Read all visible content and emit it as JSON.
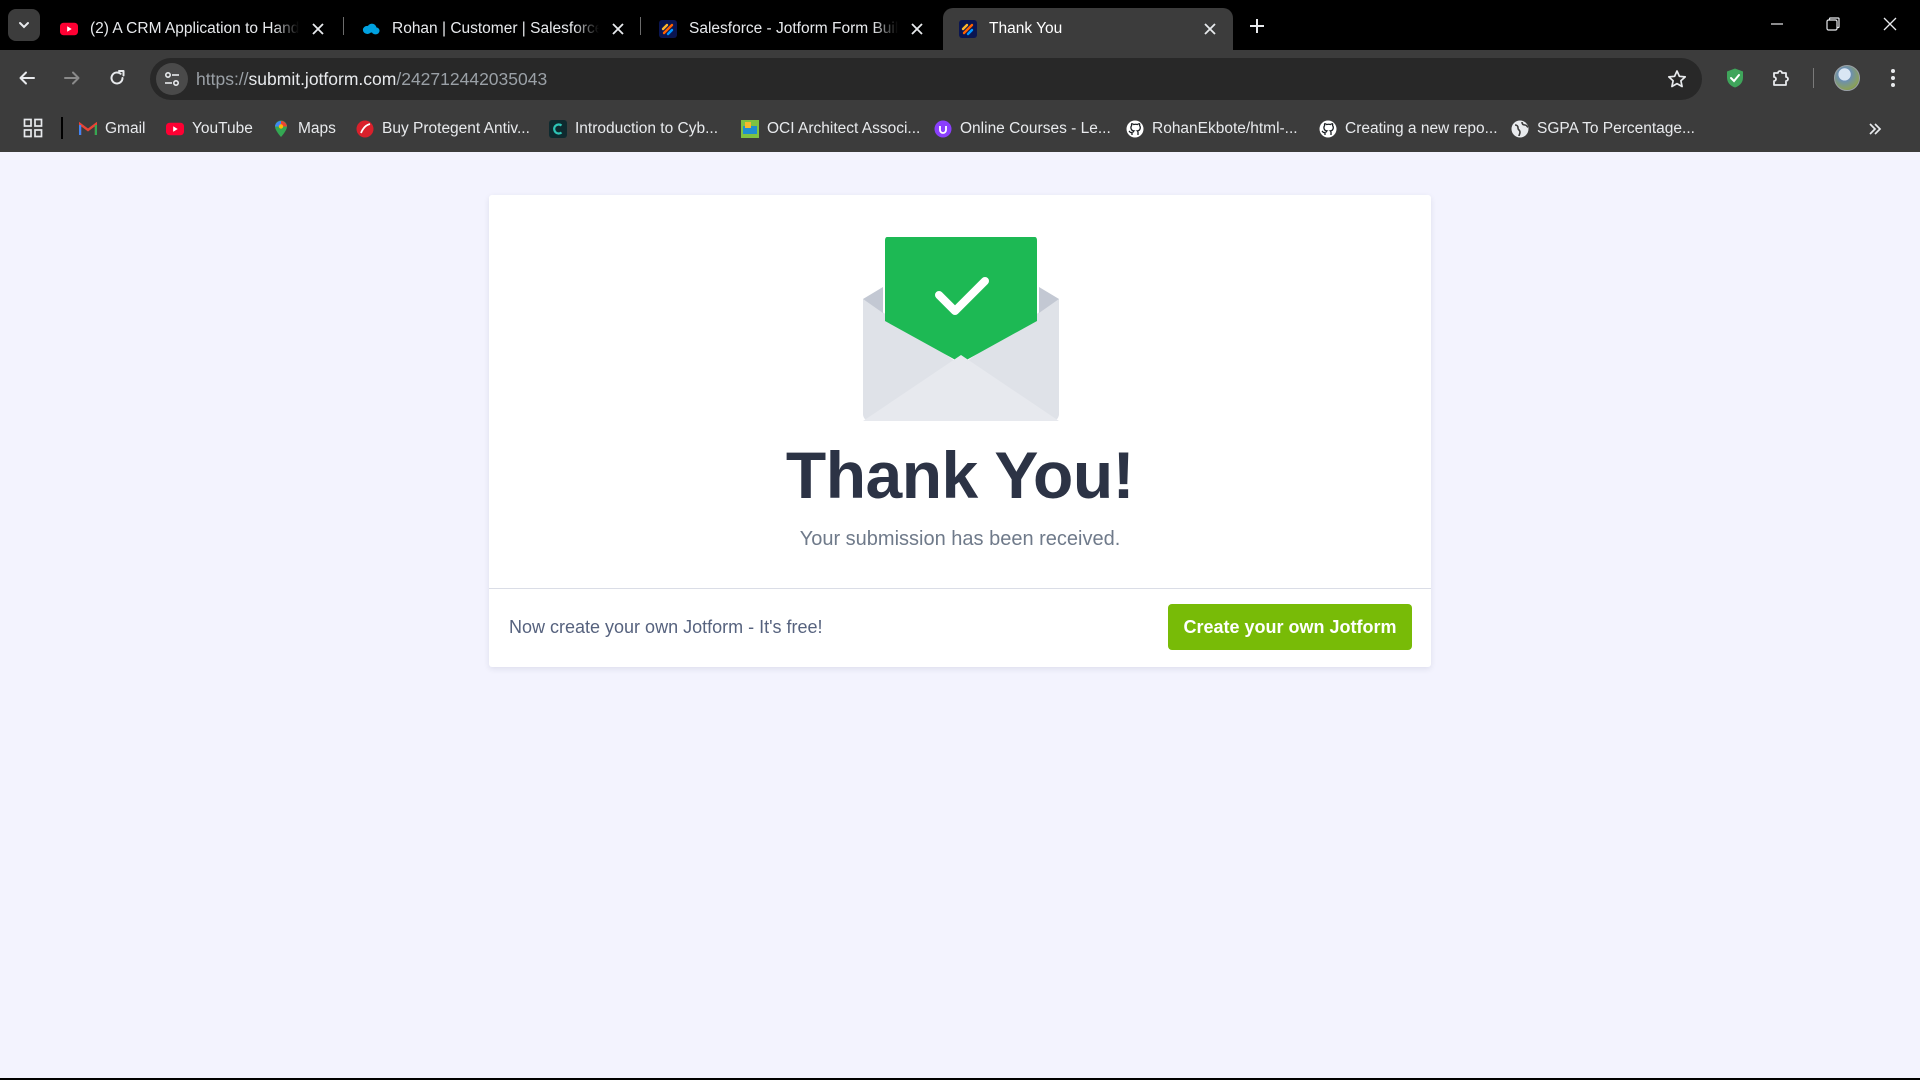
{
  "browser": {
    "tabs": [
      {
        "title": "(2) A CRM Application to Handl",
        "favicon": "youtube-icon"
      },
      {
        "title": "Rohan | Customer | Salesforce",
        "favicon": "salesforce-icon"
      },
      {
        "title": "Salesforce - Jotform Form Build",
        "favicon": "jotform-icon"
      },
      {
        "title": "Thank You",
        "favicon": "jotform-icon",
        "active": true
      }
    ],
    "url_scheme": "https://",
    "url_host": "submit.jotform.com",
    "url_path": "/242712442035043",
    "bookmarks": [
      {
        "label": "Gmail",
        "icon": "gmail-icon"
      },
      {
        "label": "YouTube",
        "icon": "youtube-icon"
      },
      {
        "label": "Maps",
        "icon": "maps-icon"
      },
      {
        "label": "Buy Protegent Antiv...",
        "icon": "protegent-icon"
      },
      {
        "label": "Introduction to Cyb...",
        "icon": "course-icon"
      },
      {
        "label": "OCI Architect Associ...",
        "icon": "oci-icon"
      },
      {
        "label": "Online Courses - Le...",
        "icon": "udemy-icon"
      },
      {
        "label": "RohanEkbote/html-...",
        "icon": "github-icon"
      },
      {
        "label": "Creating a new repo...",
        "icon": "github-icon"
      },
      {
        "label": "SGPA To Percentage...",
        "icon": "globe-icon"
      }
    ]
  },
  "page": {
    "title": "Thank You!",
    "subtitle": "Your submission has been received.",
    "footer_text": "Now create your own Jotform - It's free!",
    "cta_label": "Create your own Jotform"
  },
  "colors": {
    "accent_green": "#78bb07",
    "envelope_green": "#1db954",
    "title_text": "#2c3345",
    "page_bg": "#f3f3fe"
  }
}
